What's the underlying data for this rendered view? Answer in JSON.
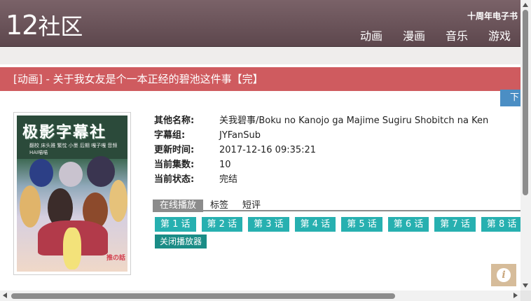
{
  "header": {
    "logo_num": "12",
    "logo_text": "社区",
    "top_link": "十周年电子书",
    "nav": [
      "动画",
      "漫画",
      "音乐",
      "游戏"
    ]
  },
  "title": "[动画] - 关于我女友是个一本正经的碧池这件事【完】",
  "side_tab": "下",
  "poster": {
    "board_title": "极影字幕社",
    "board_note": "翻校 床头雅 繁忱 小墨  后期 嘎子嘎  音频 HAI喵喵",
    "corner_text": "推の話"
  },
  "info": [
    {
      "label": "其他名称:",
      "value": "关我碧事/Boku no Kanojo ga Majime Sugiru Shobitch na Ken"
    },
    {
      "label": "字幕组:",
      "value": "JYFanSub"
    },
    {
      "label": "更新时间:",
      "value": "2017-12-16 09:35:21"
    },
    {
      "label": "当前集数:",
      "value": "10"
    },
    {
      "label": "当前状态:",
      "value": "完结"
    }
  ],
  "tabs": [
    "在线播放",
    "标签",
    "短评"
  ],
  "episodes": [
    "第 1 话",
    "第 2 话",
    "第 3 话",
    "第 4 话",
    "第 5 话",
    "第 6 话",
    "第 7 话",
    "第 8 话"
  ],
  "close_player": "关闭播放器",
  "info_icon": "i",
  "colors": {
    "header": "#6b5459",
    "title_bar": "#cf5b5f",
    "episode": "#27b0b0",
    "close": "#1a8c86",
    "side_tab": "#4b8ec4"
  }
}
